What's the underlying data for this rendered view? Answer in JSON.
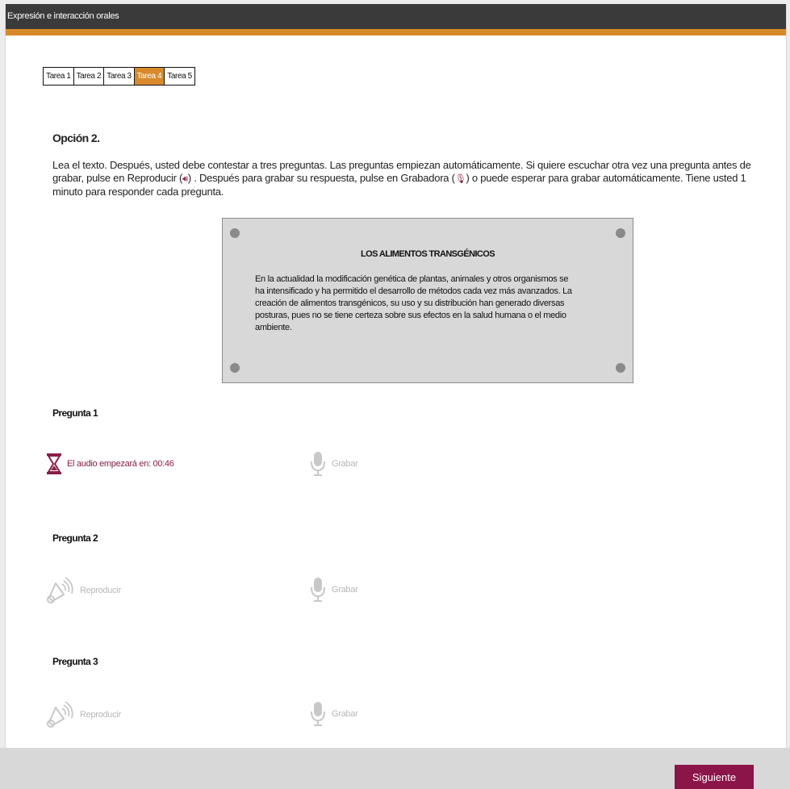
{
  "window": {
    "title": "Expresión e interacción orales"
  },
  "tabs": [
    {
      "label": "Tarea 1",
      "active": false
    },
    {
      "label": "Tarea 2",
      "active": false
    },
    {
      "label": "Tarea 3",
      "active": false
    },
    {
      "label": "Tarea 4",
      "active": true
    },
    {
      "label": "Tarea 5",
      "active": false
    }
  ],
  "option": {
    "heading": "Opción 2.",
    "instructions_part1": "Lea el texto. Después, usted debe contestar a tres preguntas. Las preguntas empiezan automáticamente. Si quiere escuchar otra vez una pregunta antes de grabar, pulse en Reproducir (",
    "instructions_part2": ") . Después para grabar su respuesta, pulse en Grabadora (",
    "instructions_part3": ") o puede esperar para grabar automáticamente. Tiene usted 1 minuto para responder cada pregunta."
  },
  "reading": {
    "title": "LOS ALIMENTOS TRANSGÉNICOS",
    "body": "En la actualidad la modificación genética de plantas, animales y otros organismos se ha intensificado y ha permitido el desarrollo de métodos cada vez más avanzados. La creación de alimentos transgénicos, su uso y su distribución han generado diversas posturas, pues no se tiene certeza sobre sus efectos en la salud humana o el medio ambiente."
  },
  "questions": [
    {
      "heading": "Pregunta 1",
      "countdown_label": "El audio empezará en: 00:46",
      "record_label": "Grabar"
    },
    {
      "heading": "Pregunta 2",
      "play_label": "Reproducir",
      "record_label": "Grabar"
    },
    {
      "heading": "Pregunta 3",
      "play_label": "Reproducir",
      "record_label": "Grabar"
    }
  ],
  "footer": {
    "next_label": "Siguiente"
  },
  "colors": {
    "accent": "#d88a2a",
    "brand": "#8b1448",
    "titlebar": "#3a3a3a",
    "disabled": "#b8b8b8"
  },
  "icons": {
    "hourglass": "hourglass-icon",
    "microphone": "microphone-icon",
    "speaker": "speaker-icon"
  }
}
